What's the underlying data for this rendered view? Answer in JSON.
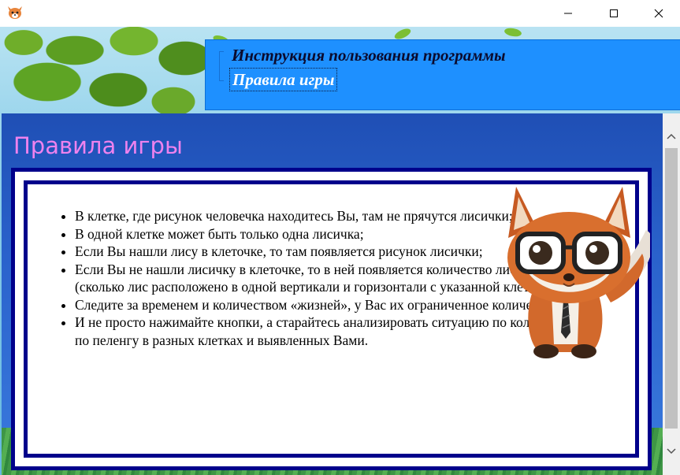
{
  "window": {
    "icon": "fox-app-icon",
    "controls": [
      "minimize-icon",
      "maximize-icon",
      "close-icon"
    ]
  },
  "menu": {
    "title": "Инструкция пользования программы",
    "link": "Правила игры"
  },
  "page": {
    "heading": "Правила игры"
  },
  "rules": [
    "В клетке, где рисунок человечка находитесь Вы, там не прячутся лисички;",
    "В одной клетке может быть только одна лисичка;",
    "Если Вы нашли лису в клеточке, то там появляется рисунок лисички;",
    "Если Вы не нашли лисичку в клеточке, то в ней появляется количество лис по пеленгу (сколько лис расположено в одной вертикали и горизонтали с указанной клеточкой);",
    "Следите за временем и количеством «жизней», у Вас их ограниченное количество.",
    "И не просто нажимайте кнопки, а старайтесь анализировать ситуацию по количеству лис по пеленгу в разных клетках и выявленных Вами."
  ],
  "colors": {
    "menu_panel": "#1e90ff",
    "heading": "#ee82ee",
    "frame_border": "#00008b",
    "content_bg": "#2a62cc"
  }
}
